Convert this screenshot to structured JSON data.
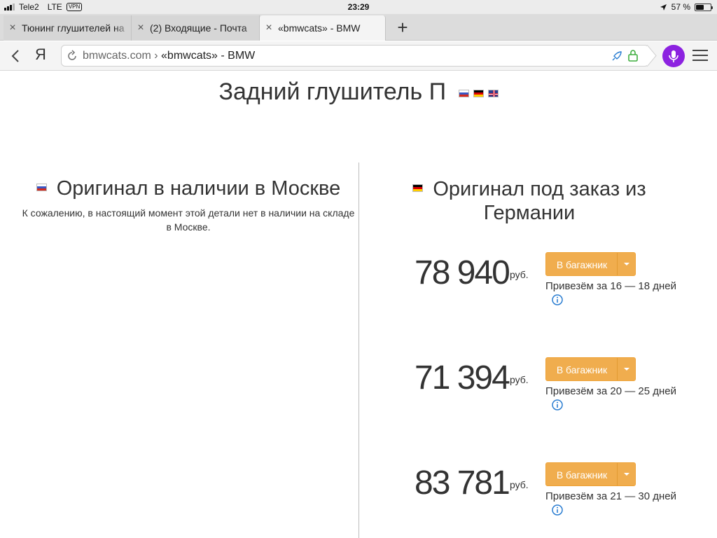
{
  "statusbar": {
    "carrier": "Tele2",
    "network": "LTE",
    "vpn": "VPN",
    "time": "23:29",
    "battery": "57 %",
    "battery_level": 0.57
  },
  "tabs": [
    {
      "title": "Тюнинг глушителей на"
    },
    {
      "title": "(2) Входящие - Почта"
    },
    {
      "title": "«bmwcats» - BMW"
    }
  ],
  "toolbar": {
    "yandex": "Я",
    "host": "bmwcats.com ›",
    "page_title": "«bmwcats» - BMW"
  },
  "page": {
    "title": "Задний глушитель П",
    "moscow": {
      "heading": "Оригинал в наличии в Москве",
      "text": "К сожалению, в настоящий момент этой детали нет в наличии на складе в Москве."
    },
    "germany": {
      "heading": "Оригинал под заказ из Германии"
    },
    "offers": [
      {
        "price": "78 940",
        "currency": "руб.",
        "button": "В багажник",
        "delivery": "Привезём за 16 — 18 дней"
      },
      {
        "price": "71 394",
        "currency": "руб.",
        "button": "В багажник",
        "delivery": "Привезём за 20 — 25 дней"
      },
      {
        "price": "83 781",
        "currency": "руб.",
        "button": "В багажник",
        "delivery": "Привезём за 21 — 30 дней"
      }
    ]
  },
  "colors": {
    "accent_button": "#f0ad4e",
    "alice": "#8c22e0",
    "info_icon": "#2a7dd1",
    "lock_icon": "#3fae3f"
  }
}
